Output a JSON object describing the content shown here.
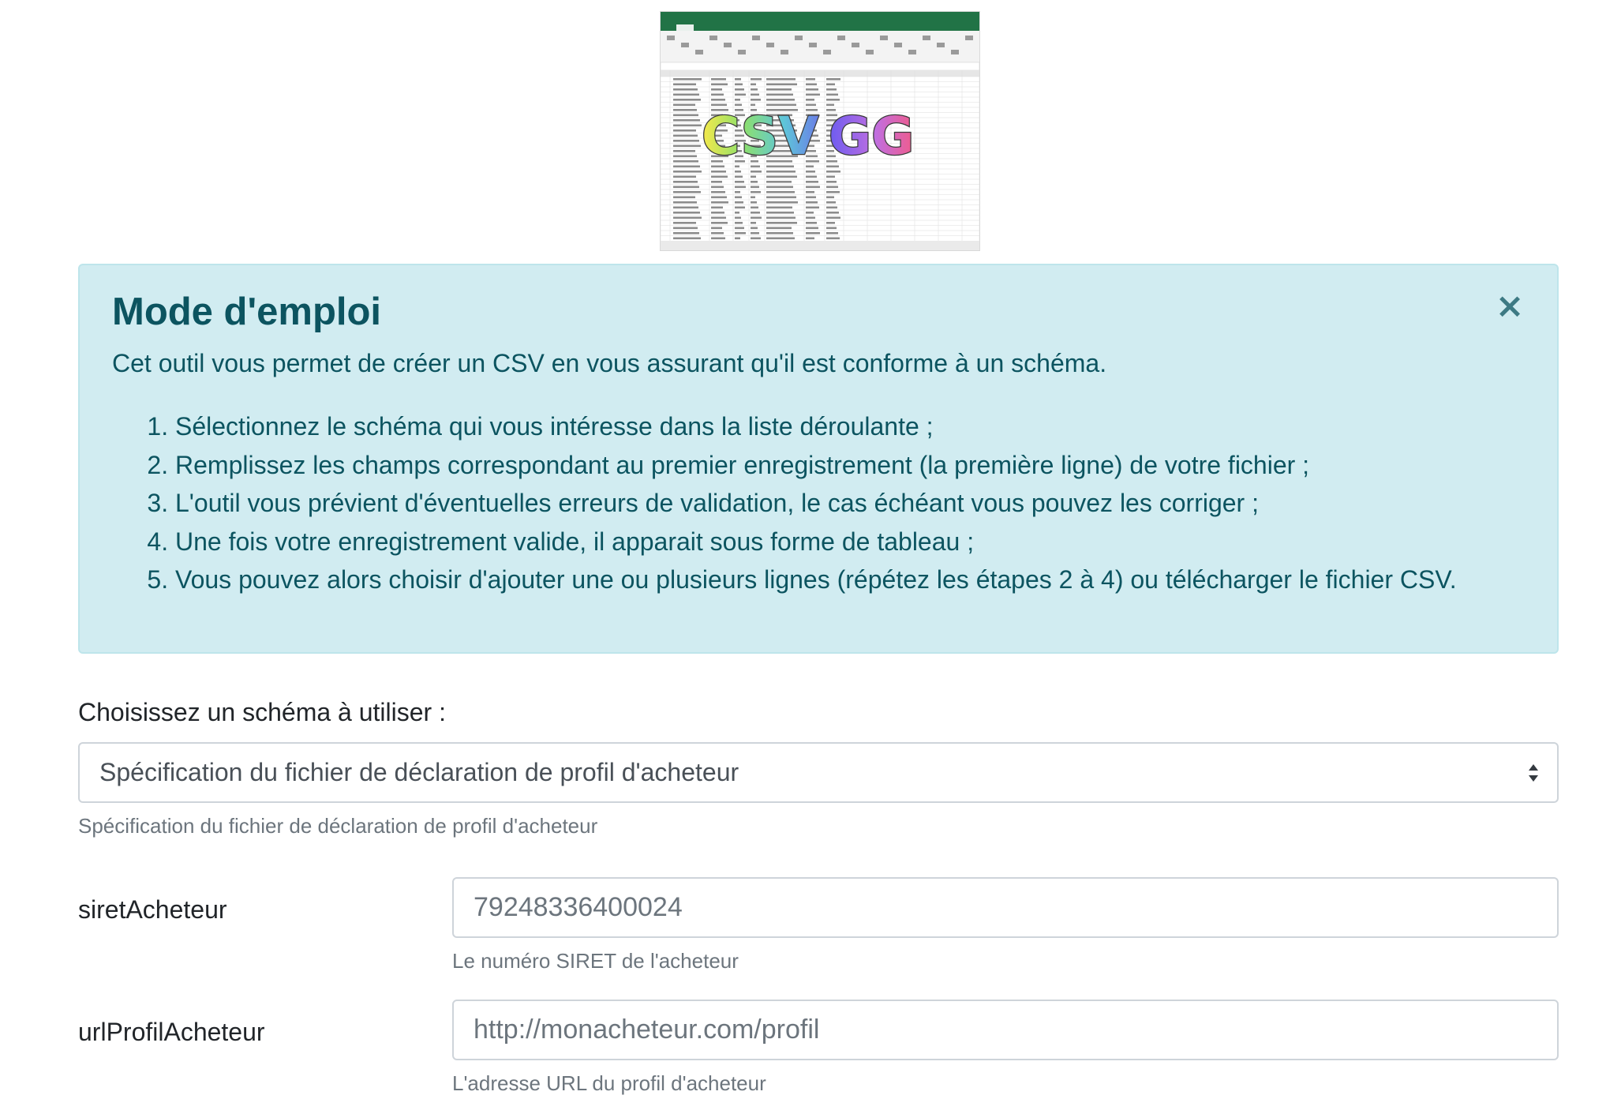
{
  "logo": {
    "text_csv": "CSV",
    "text_gg": "GG"
  },
  "instructions": {
    "title": "Mode d'emploi",
    "close_label": "×",
    "intro": "Cet outil vous permet de créer un CSV en vous assurant qu'il est conforme à un schéma.",
    "steps": [
      "Sélectionnez le schéma qui vous intéresse dans la liste déroulante ;",
      "Remplissez les champs correspondant au premier enregistrement (la première ligne) de votre fichier ;",
      "L'outil vous prévient d'éventuelles erreurs de validation, le cas échéant vous pouvez les corriger ;",
      "Une fois votre enregistrement valide, il apparait sous forme de tableau ;",
      "Vous pouvez alors choisir d'ajouter une ou plusieurs lignes (répétez les étapes 2 à 4) ou télécharger le fichier CSV."
    ]
  },
  "schema": {
    "label": "Choisissez un schéma à utiliser :",
    "selected": "Spécification du fichier de déclaration de profil d'acheteur",
    "help": "Spécification du fichier de déclaration de profil d'acheteur"
  },
  "fields": [
    {
      "label": "siretAcheteur",
      "placeholder": "79248336400024",
      "help": "Le numéro SIRET de l'acheteur"
    },
    {
      "label": "urlProfilAcheteur",
      "placeholder": "http://monacheteur.com/profil",
      "help": "L'adresse URL du profil d'acheteur"
    }
  ],
  "colors": {
    "alert_bg": "#d1ecf1",
    "alert_border": "#bee5eb",
    "alert_text": "#0c5460",
    "muted_text": "#6c757d",
    "input_border": "#ced4da",
    "excel_green": "#217346"
  }
}
